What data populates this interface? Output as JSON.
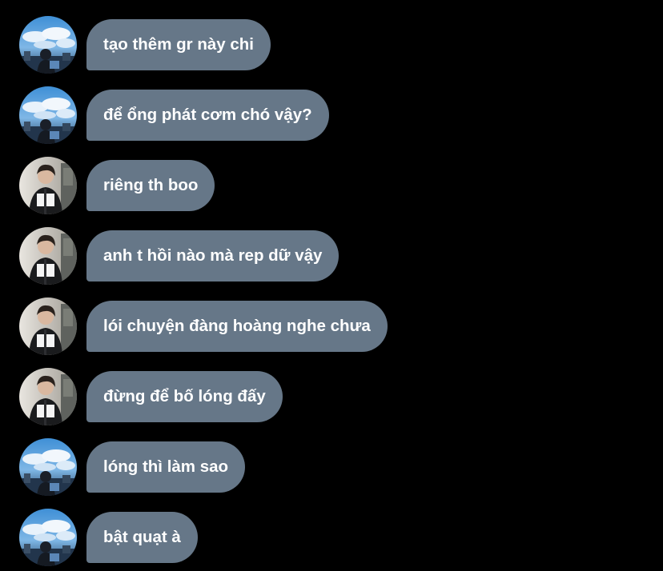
{
  "colors": {
    "background": "#000000",
    "bubble": "#667788",
    "bubble_text": "#ffffff"
  },
  "messages": [
    {
      "avatar": "sky-avatar",
      "text": "tạo thêm gr này chi"
    },
    {
      "avatar": "sky-avatar",
      "text": "để ổng phát cơm chó vậy?"
    },
    {
      "avatar": "person-avatar",
      "text": "riêng th boo"
    },
    {
      "avatar": "person-avatar",
      "text": "anh t hồi nào mà rep dữ vậy"
    },
    {
      "avatar": "person-avatar",
      "text": "lói chuyện đàng hoàng nghe chưa"
    },
    {
      "avatar": "person-avatar",
      "text": "đừng để bố lóng đấy"
    },
    {
      "avatar": "sky-avatar",
      "text": "lóng thì làm sao"
    },
    {
      "avatar": "sky-avatar",
      "text": "bật quạt à"
    }
  ]
}
